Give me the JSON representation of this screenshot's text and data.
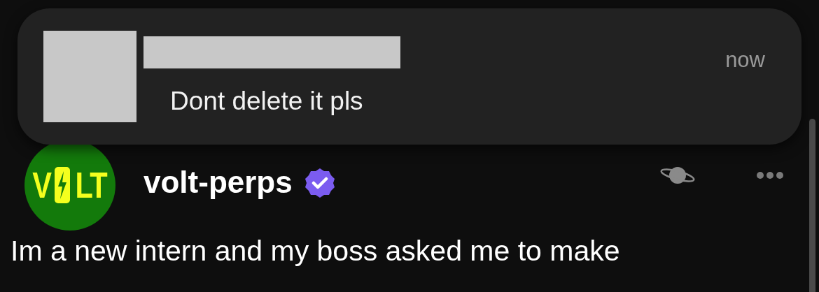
{
  "notification": {
    "message": "Dont delete it pls",
    "time": "now"
  },
  "post": {
    "logo": {
      "left": "V",
      "right": "LT"
    },
    "username": "volt-perps",
    "verified": true,
    "body": "Im a new intern and my boss asked me to make"
  }
}
